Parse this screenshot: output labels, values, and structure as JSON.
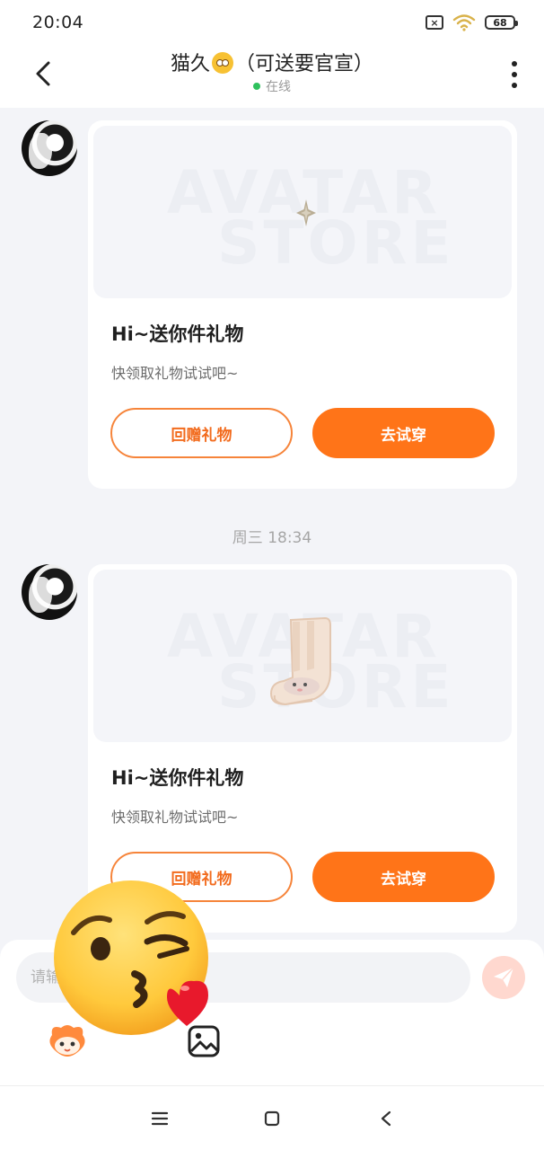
{
  "status_bar": {
    "time": "20:04",
    "battery": "68",
    "sim_label": "×"
  },
  "header": {
    "title": "猫久",
    "title_suffix": "（可送要官宣）",
    "title_emoji": "eye-roll-emoji",
    "status": "在线",
    "status_color": "#2fc15d"
  },
  "messages": [
    {
      "card": {
        "title": "Hi~送你件礼物",
        "subtitle": "快领取礼物试试吧~",
        "return_button": "回赠礼物",
        "try_button": "去试穿",
        "watermark_line1": "AVATAR",
        "watermark_line2": "STORE",
        "item_icon": "sparkle-icon"
      }
    },
    {
      "card": {
        "title": "Hi~送你件礼物",
        "subtitle": "快领取礼物试试吧~",
        "return_button": "回赠礼物",
        "try_button": "去试穿",
        "watermark_line1": "AVATAR",
        "watermark_line2": "STORE",
        "item_icon": "sock-icon"
      }
    }
  ],
  "timestamp": "周三 18:34",
  "input": {
    "placeholder": "请输入"
  },
  "colors": {
    "accent": "#ff7418",
    "accent_outline": "#f6843a",
    "send_button": "#ffd8cf",
    "background": "#f3f4f8"
  },
  "floating": {
    "emoji": "kissing-face-wink-emoji"
  }
}
